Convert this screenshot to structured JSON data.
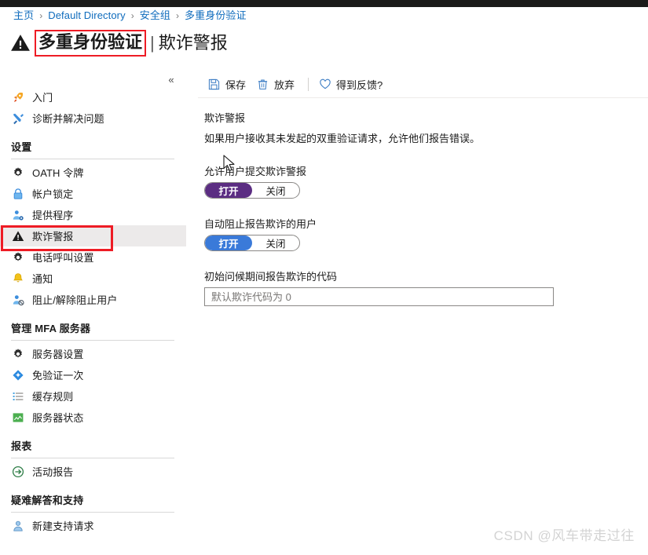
{
  "breadcrumb": {
    "separator": "›",
    "items": [
      {
        "label": "主页"
      },
      {
        "label": "Default Directory"
      },
      {
        "label": "安全组"
      },
      {
        "label": "多重身份验证"
      }
    ]
  },
  "header": {
    "icon": "warning-triangle-icon",
    "title_main": "多重身份验证",
    "title_separator": "|",
    "title_sub": "欺诈警报",
    "highlight_color": "#ee1c25"
  },
  "sidebar": {
    "collapse_label": "«",
    "blocks": [
      {
        "type": "items",
        "items": [
          {
            "label": "入门",
            "icon": "rocket-icon",
            "selected": false
          },
          {
            "label": "诊断并解决问题",
            "icon": "wrench-icon",
            "selected": false
          }
        ]
      },
      {
        "type": "group",
        "title": "设置",
        "items": [
          {
            "label": "OATH 令牌",
            "icon": "gear-icon",
            "selected": false
          },
          {
            "label": "帐户锁定",
            "icon": "lock-icon",
            "selected": false
          },
          {
            "label": "提供程序",
            "icon": "person-settings-icon",
            "selected": false
          },
          {
            "label": "欺诈警报",
            "icon": "warning-triangle-icon",
            "selected": true,
            "boxed": true
          },
          {
            "label": "电话呼叫设置",
            "icon": "gear-icon",
            "selected": false
          },
          {
            "label": "通知",
            "icon": "bell-icon",
            "selected": false
          },
          {
            "label": "阻止/解除阻止用户",
            "icon": "person-block-icon",
            "selected": false
          }
        ]
      },
      {
        "type": "group",
        "title": "管理 MFA 服务器",
        "items": [
          {
            "label": "服务器设置",
            "icon": "gear-icon",
            "selected": false
          },
          {
            "label": "免验证一次",
            "icon": "diamond-icon",
            "selected": false
          },
          {
            "label": "缓存规则",
            "icon": "list-icon",
            "selected": false
          },
          {
            "label": "服务器状态",
            "icon": "monitor-chart-icon",
            "selected": false
          }
        ]
      },
      {
        "type": "group",
        "title": "报表",
        "items": [
          {
            "label": "活动报告",
            "icon": "activity-arrow-icon",
            "selected": false
          }
        ]
      },
      {
        "type": "group",
        "title": "疑难解答和支持",
        "items": [
          {
            "label": "新建支持请求",
            "icon": "support-person-icon",
            "selected": false
          }
        ]
      }
    ]
  },
  "toolbar": {
    "save_label": "保存",
    "save_icon": "save-disk-icon",
    "discard_label": "放弃",
    "discard_icon": "trash-icon",
    "feedback_label": "得到反馈?",
    "feedback_icon": "heart-icon"
  },
  "main": {
    "section_title": "欺诈警报",
    "section_desc": "如果用户接收其未发起的双重验证请求，允许他们报告错误。",
    "toggles": [
      {
        "label": "允许用户提交欺诈警报",
        "on_label": "打开",
        "off_label": "关闭",
        "value": "打开",
        "hovered": true,
        "on_color": "#5b2d82"
      },
      {
        "label": "自动阻止报告欺诈的用户",
        "on_label": "打开",
        "off_label": "关闭",
        "value": "打开",
        "hovered": false,
        "on_color": "#3a7ad9"
      }
    ],
    "code_field": {
      "label": "初始问候期间报告欺诈的代码",
      "value": "",
      "placeholder": "默认欺诈代码为 0"
    }
  },
  "watermark": {
    "text": "CSDN @风车带走过往"
  }
}
